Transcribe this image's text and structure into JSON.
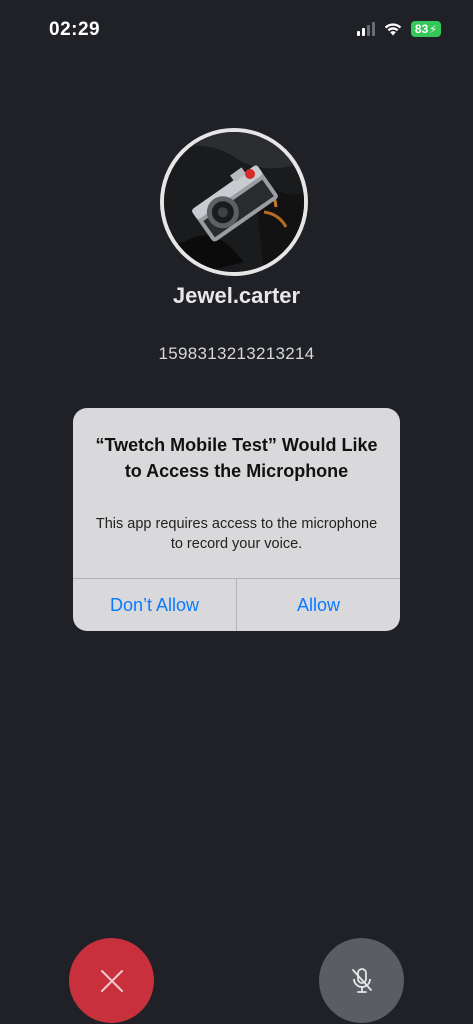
{
  "status_bar": {
    "time": "02:29",
    "battery": "83",
    "battery_color": "#34c759"
  },
  "contact": {
    "name": "Jewel.carter",
    "number": "1598313213213214",
    "avatar_icon": "camera-photo"
  },
  "alert": {
    "title": "“Twetch Mobile Test” Would Like to Access the Microphone",
    "message": "This app requires access to the microphone to record your voice.",
    "deny_label": "Don’t Allow",
    "allow_label": "Allow",
    "button_color": "#0a7aff"
  },
  "controls": {
    "end_call_icon": "close-icon",
    "end_call_color": "#c8313c",
    "mute_icon": "microphone-slash-icon",
    "mute_color": "#5a5d63"
  }
}
